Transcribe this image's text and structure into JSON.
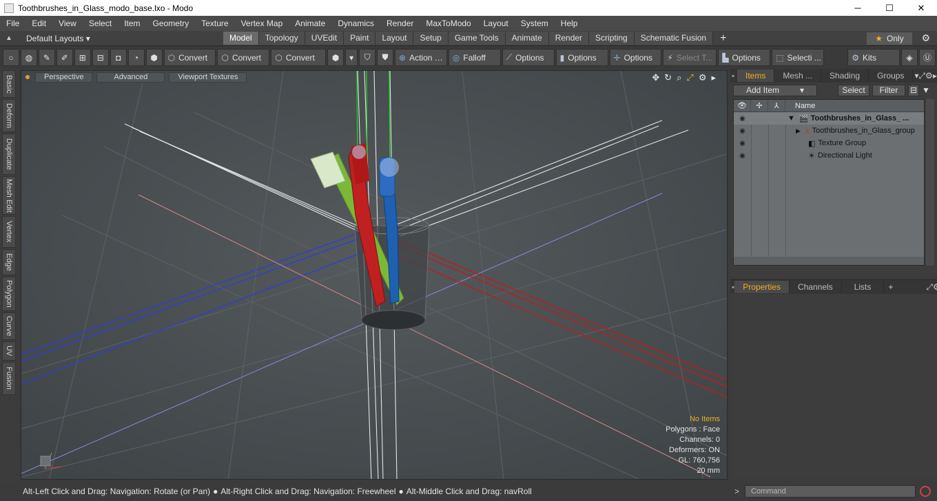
{
  "window": {
    "title": "Toothbrushes_in_Glass_modo_base.lxo - Modo",
    "minimize": "─",
    "maximize": "☐",
    "close": "✕"
  },
  "menu": [
    "File",
    "Edit",
    "View",
    "Select",
    "Item",
    "Geometry",
    "Texture",
    "Vertex Map",
    "Animate",
    "Dynamics",
    "Render",
    "MaxToModo",
    "Layout",
    "System",
    "Help"
  ],
  "layouts": {
    "label": "Default Layouts ▾"
  },
  "tabs": [
    {
      "label": "Model",
      "active": true
    },
    {
      "label": "Topology"
    },
    {
      "label": "UVEdit"
    },
    {
      "label": "Paint"
    },
    {
      "label": "Layout"
    },
    {
      "label": "Setup"
    },
    {
      "label": "Game Tools"
    },
    {
      "label": "Animate"
    },
    {
      "label": "Render"
    },
    {
      "label": "Scripting"
    },
    {
      "label": "Schematic Fusion"
    }
  ],
  "tab_plus": "+",
  "only": {
    "label": "Only",
    "star": "★"
  },
  "toolbar": {
    "convert1": "Convert",
    "convert2": "Convert",
    "convert3": "Convert",
    "action": "Action",
    "falloff": "Falloff",
    "options1": "Options",
    "options2": "Options",
    "options3": "Options",
    "select_t": "Select T...",
    "options4": "Options",
    "selecti": "Selecti ...",
    "kits": "Kits"
  },
  "left_tabs": [
    "Basic",
    "Deform",
    "Duplicate",
    "Mesh Edit",
    "Vertex",
    "Edge",
    "Polygon",
    "Curve",
    "UV",
    "Fusion"
  ],
  "viewport": {
    "perspective": "Perspective",
    "advanced": "Advanced",
    "textures": "Viewport Textures",
    "info": {
      "no_items": "No Items",
      "polygons": "Polygons : Face",
      "channels": "Channels: 0",
      "deformers": "Deformers: ON",
      "gl": "GL: 760,756",
      "scale": "20 mm"
    }
  },
  "items_panel": {
    "tabs": [
      "Items",
      "Mesh ...",
      "Shading",
      "Groups"
    ],
    "add_item": "Add Item",
    "select": "Select",
    "filter": "Filter",
    "name_header": "Name",
    "rows": [
      {
        "label": "Toothbrushes_in_Glass_ ...",
        "bold": true
      },
      {
        "label": "Toothbrushes_in_Glass_group"
      },
      {
        "label": "Texture Group"
      },
      {
        "label": "Directional Light"
      }
    ]
  },
  "properties_panel": {
    "tabs": [
      "Properties",
      "Channels",
      "Lists"
    ],
    "plus": "+"
  },
  "status": {
    "hint1": "Alt-Left Click and Drag: Navigation: Rotate (or Pan)",
    "hint2": "Alt-Right Click and Drag: Navigation: Freewheel",
    "hint3": "Alt-Middle Click and Drag: navRoll",
    "bullet": "●"
  },
  "command": {
    "placeholder": "Command",
    "prompt": ">"
  }
}
